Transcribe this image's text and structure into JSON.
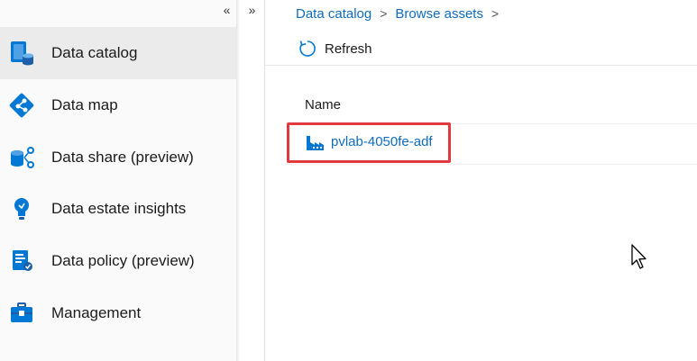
{
  "sidebar": {
    "collapse_glyph": "«",
    "items": [
      {
        "label": "Data catalog",
        "icon": "data-catalog-icon",
        "selected": true
      },
      {
        "label": "Data map",
        "icon": "data-map-icon",
        "selected": false
      },
      {
        "label": "Data share (preview)",
        "icon": "data-share-icon",
        "selected": false
      },
      {
        "label": "Data estate insights",
        "icon": "insights-lightbulb-icon",
        "selected": false
      },
      {
        "label": "Data policy (preview)",
        "icon": "data-policy-icon",
        "selected": false
      },
      {
        "label": "Management",
        "icon": "management-toolbox-icon",
        "selected": false
      }
    ]
  },
  "gutter": {
    "expand_glyph": "»"
  },
  "breadcrumb": {
    "items": [
      "Data catalog",
      "Browse assets"
    ],
    "separator": ">"
  },
  "toolbar": {
    "refresh_label": "Refresh"
  },
  "table": {
    "column_header": "Name",
    "rows": [
      {
        "name": "pvlab-4050fe-adf",
        "icon": "data-factory-icon",
        "highlighted": true
      }
    ]
  },
  "colors": {
    "link": "#0f6cbd",
    "highlight_border": "#e03a3e",
    "selected_nav_bg": "#ebebeb",
    "icon_blue": "#0078d4"
  }
}
